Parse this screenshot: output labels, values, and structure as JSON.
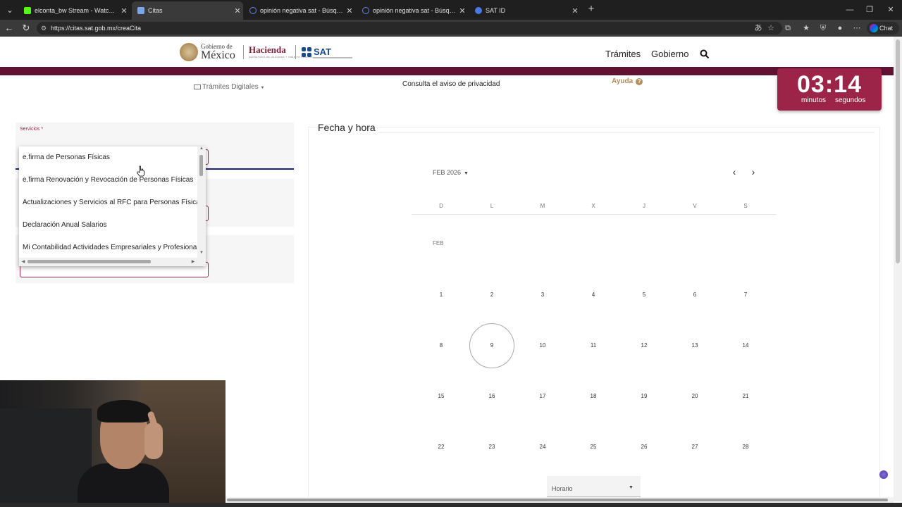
{
  "browser": {
    "tabs": [
      {
        "title": "elconta_bw Stream - Watch Live o",
        "favicon_color": "#53fc18",
        "active": false
      },
      {
        "title": "Citas",
        "favicon_color": "#7aa7e8",
        "active": true
      },
      {
        "title": "opinión negativa sat - Búsqueda",
        "favicon_color": "#5b8be8",
        "active": false
      },
      {
        "title": "opinión negativa sat - Búsqueda li",
        "favicon_color": "#5b8be8",
        "active": false
      },
      {
        "title": "SAT ID",
        "favicon_color": "#4a7ae0",
        "active": false
      }
    ],
    "url": "https://citas.sat.gob.mx/creaCita",
    "chat_label": "Chat"
  },
  "header": {
    "gob_small": "Gobierno de",
    "gob_big": "México",
    "hacienda": "Hacienda",
    "hacienda_sub": "SECRETARÍA DE HACIENDA Y CRÉDITO PÚBLICO",
    "sat": "SAT",
    "nav": [
      "Trámites",
      "Gobierno"
    ]
  },
  "subnav": {
    "tramites_digitales": "Trámites Digitales",
    "privacidad": "Consulta el aviso de privacidad",
    "ayuda": "Ayuda"
  },
  "timer": {
    "value": "03:14",
    "minutes_label": "minutos",
    "seconds_label": "segundos"
  },
  "form": {
    "servicios_label": "Servicios *",
    "dropdown_options": [
      "e.firma de Personas Físicas",
      "e.firma Renovación y Revocación de Personas Físicas",
      "Actualizaciones y Servicios al RFC para Personas Físicas",
      "Declaración Anual Salarios",
      "Mi Contabilidad Actividades Empresariales y Profesionales"
    ]
  },
  "calendar": {
    "section_title": "Fecha y hora",
    "month_selector": "FEB 2026",
    "weekdays": [
      "D",
      "L",
      "M",
      "X",
      "J",
      "V",
      "S"
    ],
    "month_label": "FEB",
    "weeks": [
      [
        "1",
        "2",
        "3",
        "4",
        "5",
        "6",
        "7"
      ],
      [
        "8",
        "9",
        "10",
        "11",
        "12",
        "13",
        "14"
      ],
      [
        "15",
        "16",
        "17",
        "18",
        "19",
        "20",
        "21"
      ],
      [
        "22",
        "23",
        "24",
        "25",
        "26",
        "27",
        "28"
      ]
    ],
    "highlighted_day": "9",
    "horario_label": "Horario"
  },
  "colors": {
    "maroon": "#611232",
    "timer_bg": "#9d2449",
    "gold": "#b38e5d"
  }
}
